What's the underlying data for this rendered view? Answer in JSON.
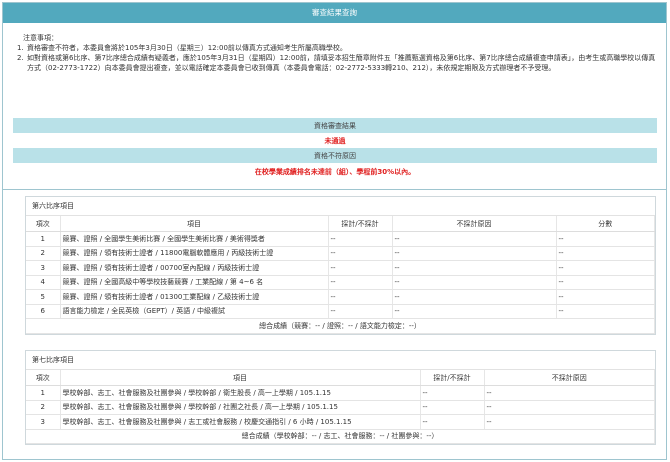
{
  "header": {
    "title": "審查結果查詢"
  },
  "notes": {
    "title": "注意事項：",
    "items": [
      {
        "num": "1.",
        "text": "資格審查不符者，本委員會將於105年3月30日（星期三）12:00前以傳真方式通知考生所屬高職學校。"
      },
      {
        "num": "2.",
        "text": "如對資格或第6比序、第7比序總合成績有疑義者，應於105年3月31日（星期四）12:00前，請填妥本招生簡章附件五「推薦甄選資格及第6比序、第7比序總合成績複查申請表」，由考生或高職學校以傳真方式（02-2773-1722）向本委員會提出複查，並以電話確定本委員會已收到傳真（本委員會電話：02-2772-5333轉210、212），未依規定期限及方式辦理者不予受理。"
      }
    ]
  },
  "result": {
    "qual_label": "資格審查結果",
    "qual_value": "未通過",
    "reason_label": "資格不符原因",
    "reason_value": "在校學業成績排名未達前（組）、學程前30%以內。"
  },
  "section6": {
    "title": "第六比序項目",
    "headers": [
      "項次",
      "項目",
      "採計/不採計",
      "不採計原因",
      "分數"
    ],
    "rows": [
      [
        "1",
        "競賽、證照 / 全國學生美術比賽 / 全國學生美術比賽 / 美術得獎者",
        "--",
        "--",
        "--"
      ],
      [
        "2",
        "競賽、證照 / 領有技術士證者 / 11800電腦軟體應用 / 丙級技術士證",
        "--",
        "--",
        "--"
      ],
      [
        "3",
        "競賽、證照 / 領有技術士證者 / 00700室內配線 / 丙級技術士證",
        "--",
        "--",
        "--"
      ],
      [
        "4",
        "競賽、證照 / 全國高級中等學校技藝競賽 / 工業配線 / 第 4~6 名",
        "--",
        "--",
        "--"
      ],
      [
        "5",
        "競賽、證照 / 領有技術士證者 / 01300工業配線 / 乙級技術士證",
        "--",
        "--",
        "--"
      ],
      [
        "6",
        "語言能力檢定 / 全民英檢（GEPT）/ 英語 / 中級複試",
        "--",
        "--",
        "--"
      ]
    ],
    "footer": "總合成績（競賽：-- / 證照：-- / 語文能力檢定：--）"
  },
  "section7": {
    "title": "第七比序項目",
    "headers": [
      "項次",
      "項目",
      "採計/不採計",
      "不採計原因"
    ],
    "rows": [
      [
        "1",
        "學校幹部、志工、社會服務及社團參與 / 學校幹部 / 衛生股長 / 高一上學期 / 105.1.15",
        "--",
        "--"
      ],
      [
        "2",
        "學校幹部、志工、社會服務及社團參與 / 學校幹部 / 社團之社長 / 高一上學期 / 105.1.15",
        "--",
        "--"
      ],
      [
        "3",
        "學校幹部、志工、社會服務及社團參與 / 志工或社會服務 / 校慶交通指引 / 6 小時 / 105.1.15",
        "--",
        "--"
      ]
    ],
    "footer": "總合成績（學校幹部：-- / 志工、社會服務：-- / 社團參與：--）"
  }
}
